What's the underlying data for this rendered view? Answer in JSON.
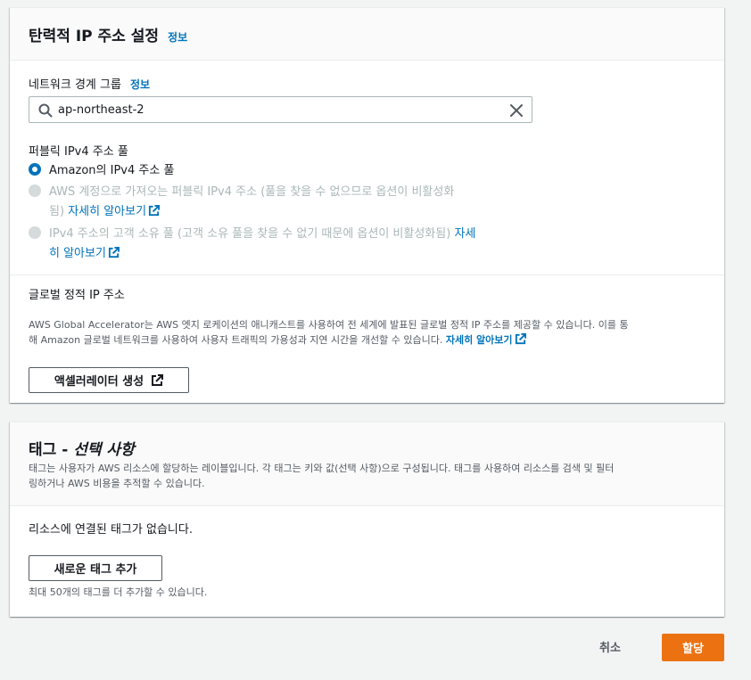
{
  "eip_panel": {
    "title": "탄력적 IP 주소 설정",
    "info": "정보",
    "network_border_group": {
      "label": "네트워크 경계 그룹",
      "info": "정보",
      "value": "ap-northeast-2"
    },
    "ipv4_pool": {
      "label": "퍼블릭 IPv4 주소 풀",
      "options": [
        {
          "label": "Amazon의 IPv4 주소 풀",
          "selected": true,
          "disabled": false
        },
        {
          "label_line1": "AWS 계정으로 가져오는 퍼블릭 IPv4 주소 (풀을 찾을 수 없으므로 옵션이 비활성화",
          "label_line2": "됨)",
          "link": "자세히 알아보기",
          "selected": false,
          "disabled": true
        },
        {
          "label_line1": "IPv4 주소의 고객 소유 풀 (고객 소유 풀을 찾을 수 없기 때문에 옵션이 비활성화됨)",
          "link_part1": "자세",
          "link_part2": "히 알아보기",
          "selected": false,
          "disabled": true
        }
      ]
    },
    "global_static_ip": {
      "label": "글로벌 정적 IP 주소",
      "description_line1": "AWS Global Accelerator는 AWS 엣지 로케이션의 애니캐스트를 사용하여 전 세계에 발표된 글로벌 정적 IP 주소를 제공할 수 있습니다. 이를 통",
      "description_line2": "해 Amazon 글로벌 네트워크를 사용하여 사용자 트래픽의 가용성과 지연 시간을 개선할 수 있습니다.",
      "learn_more": "자세히 알아보기",
      "create_button": "액셀러레이터 생성"
    }
  },
  "tags_panel": {
    "title_prefix": "태그 -",
    "title_optional": "선택 사항",
    "description_line1": "태그는 사용자가 AWS 리소스에 할당하는 레이블입니다. 각 태그는 키와 값(선택 사항)으로 구성됩니다. 태그를 사용하여 리소스를 검색 및 필터",
    "description_line2": "링하거나 AWS 비용을 추적할 수 있습니다.",
    "empty_text": "리소스에 연결된 태그가 없습니다.",
    "add_button": "새로운 태그 추가",
    "limit_text": "최대 50개의 태그를 더 추가할 수 있습니다."
  },
  "footer": {
    "cancel": "취소",
    "submit": "할당"
  },
  "colors": {
    "link": "#0073bb",
    "primary": "#ec7211",
    "background": "#f2f3f3"
  }
}
